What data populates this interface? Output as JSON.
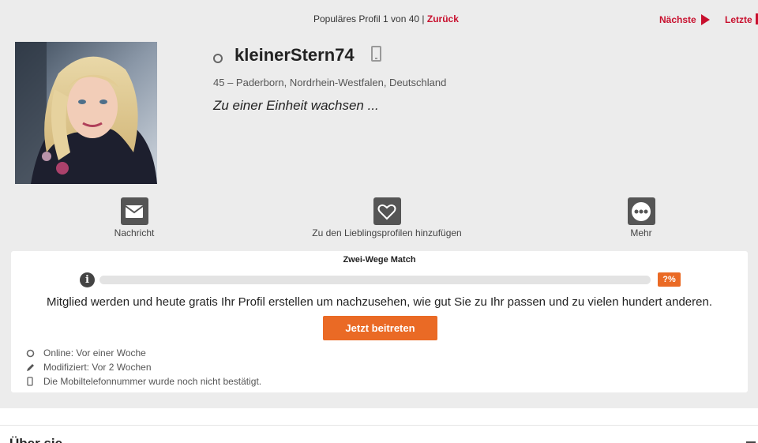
{
  "topnav": {
    "counter": "Populäres Profil 1 von 40 |",
    "back": "Zurück",
    "next": "Nächste",
    "last": "Letzte"
  },
  "profile": {
    "username": "kleinerStern74",
    "location": "45 – Paderborn, Nordrhein-Westfalen, Deutschland",
    "tagline": "Zu einer Einheit wachsen ..."
  },
  "actions": [
    {
      "label": "Nachricht",
      "icon": "mail-icon"
    },
    {
      "label": "Zu den Lieblingsprofilen hinzufügen",
      "icon": "heart-icon"
    },
    {
      "label": "Mehr",
      "icon": "more-icon"
    }
  ],
  "match": {
    "title": "Zwei-Wege Match",
    "percent_label": "?%",
    "progress_fraction": 0,
    "cta_text": "Mitglied werden und heute gratis Ihr Profil erstellen um nachzusehen, wie gut Sie zu Ihr passen und zu vielen hundert anderen.",
    "button_label": "Jetzt beitreten"
  },
  "meta": [
    {
      "text": "Online: Vor einer Woche",
      "icon": "online-status-icon"
    },
    {
      "text": "Modifiziert: Vor 2 Wochen",
      "icon": "pencil-icon"
    },
    {
      "text": "Die Mobiltelefonnummer wurde noch nicht bestätigt.",
      "icon": "mobile-icon"
    }
  ],
  "section": {
    "heading": "Über sie"
  },
  "colors": {
    "accent_red": "#c8102e",
    "accent_orange": "#ea6a25",
    "background": "#ececec"
  }
}
